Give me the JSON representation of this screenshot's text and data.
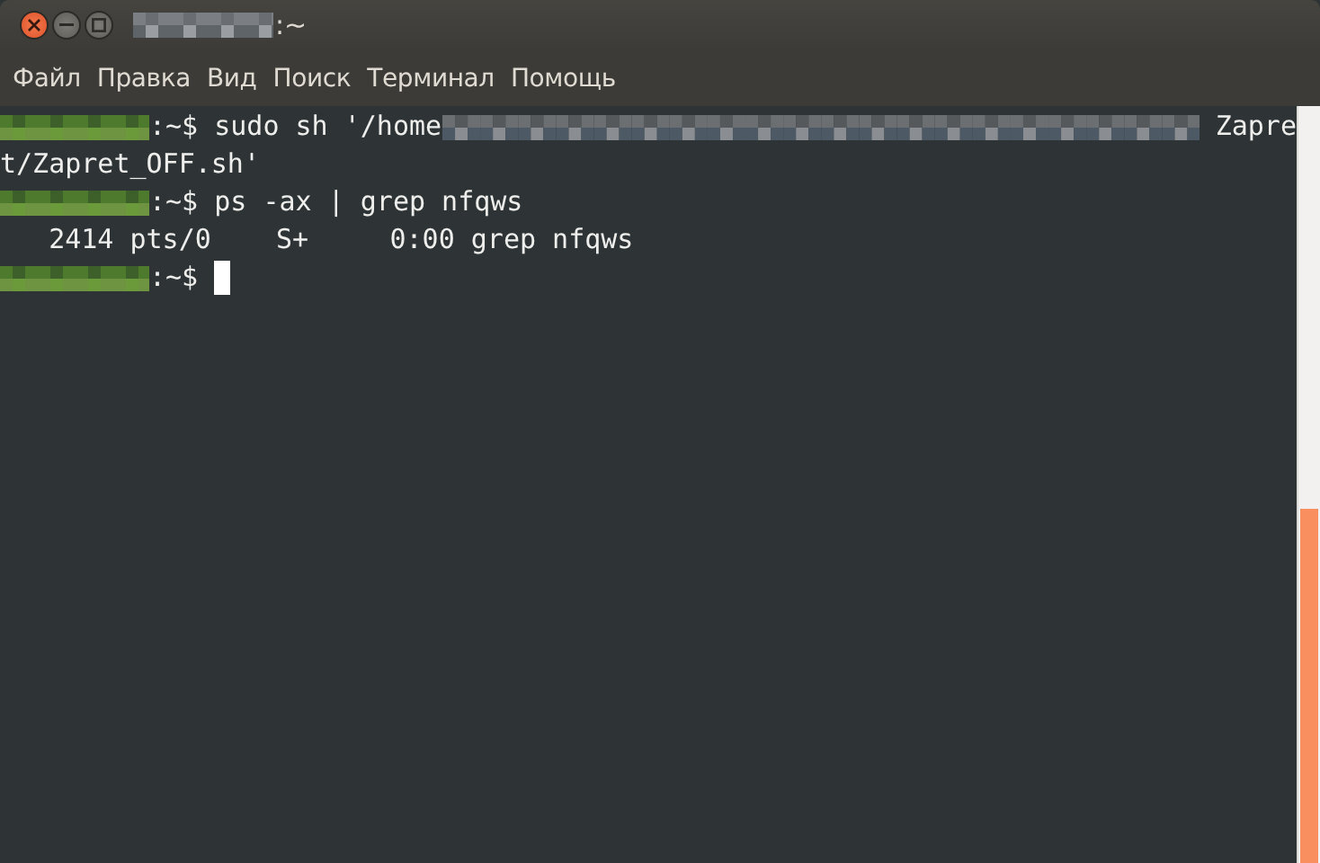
{
  "window": {
    "title": [
      {
        "kind": "redacted-title"
      },
      {
        "kind": "text",
        "text": ":~"
      }
    ]
  },
  "menu": [
    "Файл",
    "Правка",
    "Вид",
    "Поиск",
    "Терминал",
    "Помощь"
  ],
  "terminal": {
    "lines": [
      {
        "cursor": false,
        "segments": [
          {
            "kind": "redacted-user"
          },
          {
            "kind": "text",
            "text": ":~$ sudo sh '/home"
          },
          {
            "kind": "redacted-path"
          },
          {
            "kind": "text",
            "text": "Zapre"
          }
        ]
      },
      {
        "cursor": false,
        "segments": [
          {
            "kind": "text",
            "text": "t/Zapret_OFF.sh'"
          }
        ]
      },
      {
        "cursor": false,
        "segments": [
          {
            "kind": "redacted-user"
          },
          {
            "kind": "text",
            "text": ":~$ ps -ax | grep nfqws"
          }
        ]
      },
      {
        "cursor": false,
        "segments": [
          {
            "kind": "text",
            "text": "   2414 pts/0    S+     0:00 grep nfqws"
          }
        ]
      },
      {
        "cursor": true,
        "segments": [
          {
            "kind": "redacted-user"
          },
          {
            "kind": "text",
            "text": ":~$ "
          }
        ]
      }
    ]
  }
}
